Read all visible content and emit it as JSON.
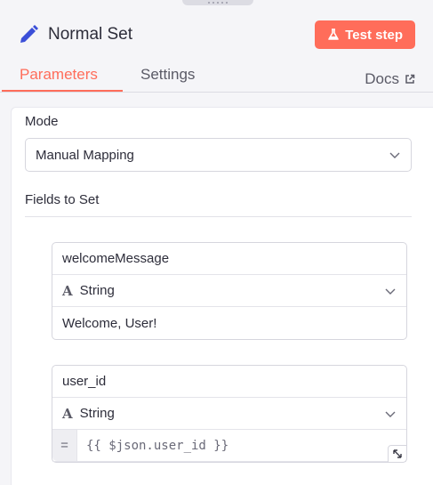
{
  "header": {
    "title": "Normal Set",
    "node_icon": "pencil-icon",
    "test_button_label": "Test step",
    "test_button_icon": "flask-icon",
    "accent_color": "#ff6d5a"
  },
  "tabs": {
    "parameters": "Parameters",
    "settings": "Settings",
    "docs": "Docs",
    "active": "Parameters"
  },
  "mode": {
    "label": "Mode",
    "value": "Manual Mapping"
  },
  "fields_section": {
    "label": "Fields to Set"
  },
  "fields": [
    {
      "name": "welcomeMessage",
      "type": "String",
      "value": "Welcome, User!"
    },
    {
      "name": "user_id",
      "type": "String",
      "expression_prefix": "=",
      "value": "{{ $json.user_id }}"
    }
  ]
}
